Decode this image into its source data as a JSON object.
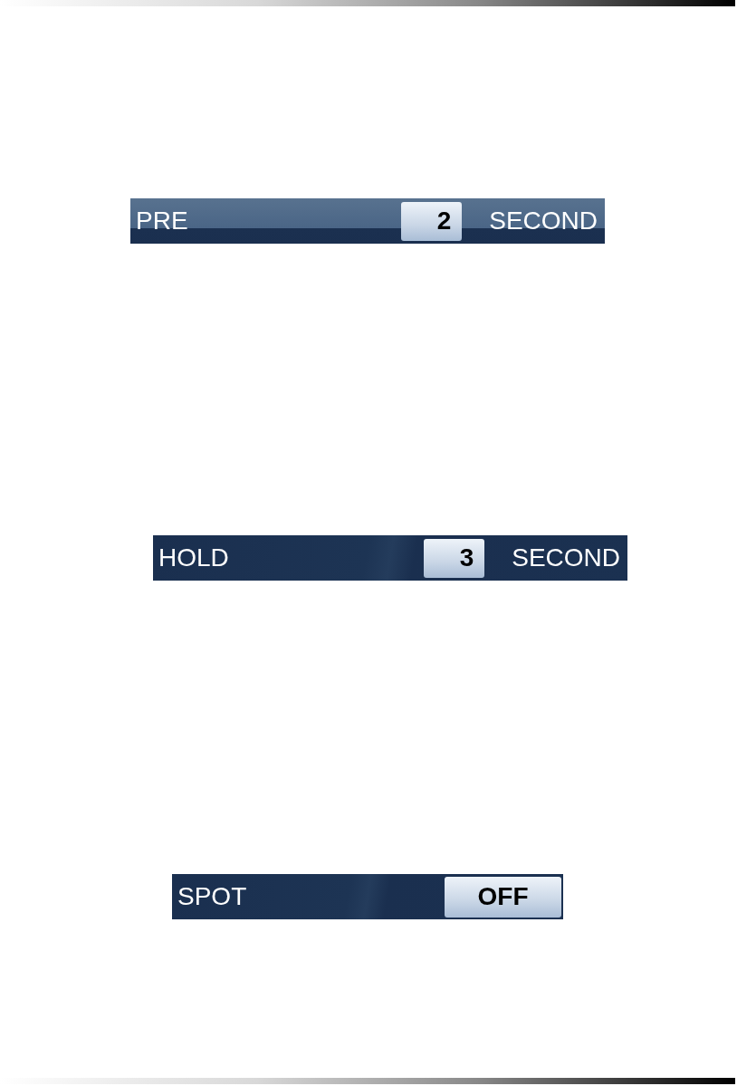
{
  "rows": [
    {
      "kind": "stepper",
      "label": "PRE",
      "value": "2",
      "unit": "SECOND",
      "selected": true
    },
    {
      "kind": "stepper",
      "label": "HOLD",
      "value": "3",
      "unit": "SECOND",
      "selected": false
    },
    {
      "kind": "toggle",
      "label": "SPOT",
      "value": "OFF",
      "selected": false
    }
  ]
}
